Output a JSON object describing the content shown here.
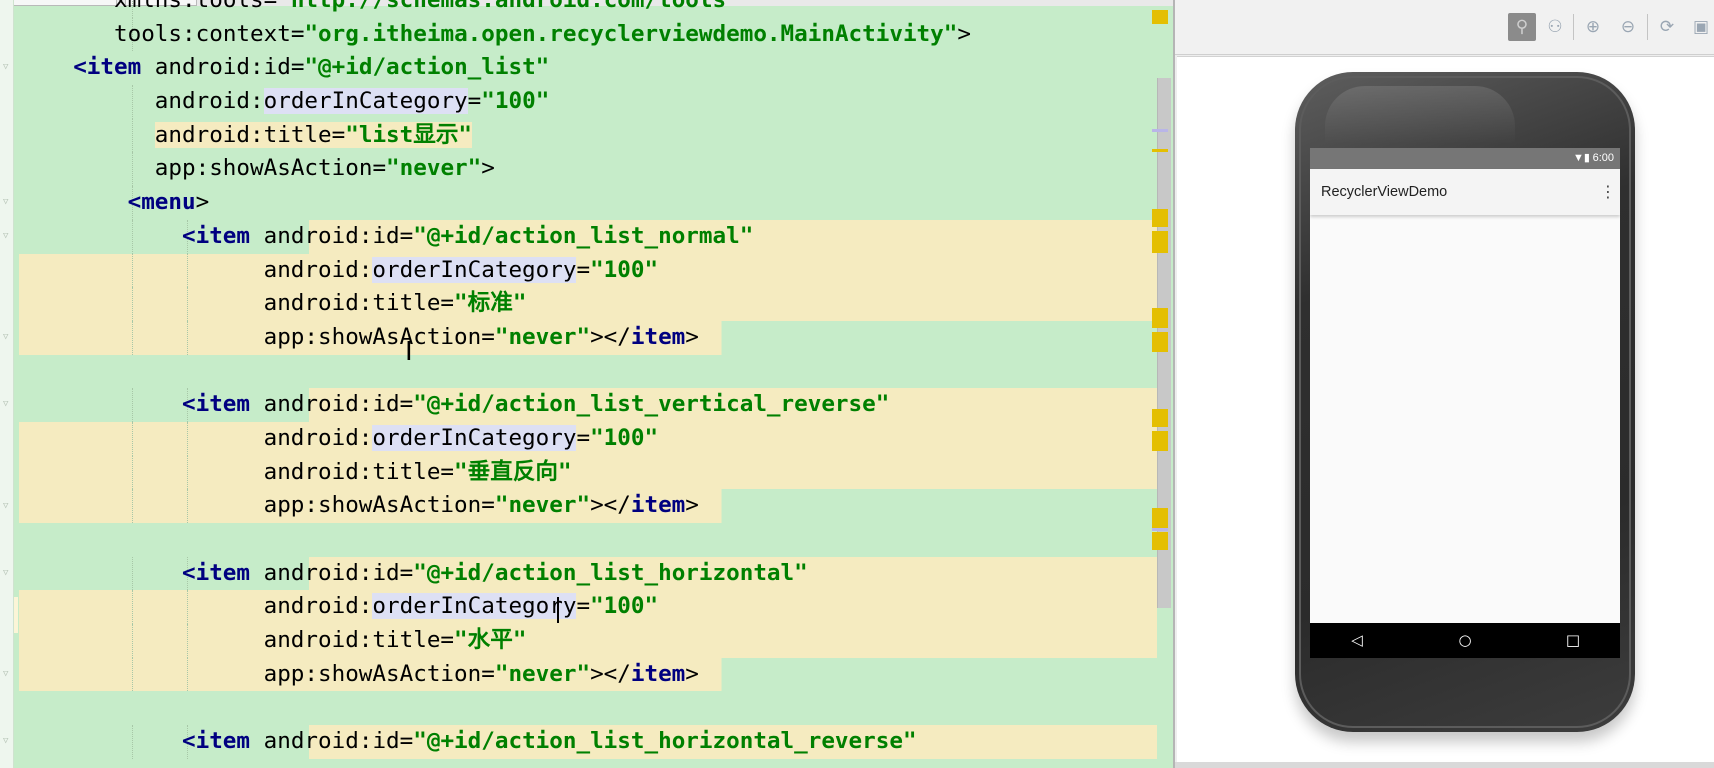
{
  "editor": {
    "lines": [
      {
        "indent": 5,
        "bg": "g",
        "tokens": [
          [
            "a",
            "xmlns:tools="
          ],
          [
            "v",
            "\"http://schemas.android.com/tools\""
          ]
        ]
      },
      {
        "indent": 5,
        "bg": "g",
        "tokens": [
          [
            "a",
            "tools:context="
          ],
          [
            "v",
            "\"org.itheima.open.recyclerviewdemo.MainActivity\""
          ],
          [
            "a",
            ">"
          ]
        ]
      },
      {
        "indent": 2,
        "bg": "g",
        "tokens": [
          [
            "t",
            "<item"
          ],
          [
            "a",
            " android:id="
          ],
          [
            "v",
            "\"@+id/action_list\""
          ]
        ]
      },
      {
        "indent": 8,
        "bg": "g",
        "tokens": [
          [
            "a",
            "android:"
          ],
          [
            "h",
            "orderInCategory"
          ],
          [
            "a",
            "="
          ],
          [
            "v",
            "\"100\""
          ]
        ]
      },
      {
        "indent": 8,
        "bg": "g",
        "tokens": [
          [
            "yb",
            "android:title="
          ],
          [
            "yv",
            "\"list显示\""
          ]
        ]
      },
      {
        "indent": 8,
        "bg": "g",
        "tokens": [
          [
            "a",
            "app:showAsAction="
          ],
          [
            "v",
            "\"never\""
          ],
          [
            "a",
            ">"
          ]
        ]
      },
      {
        "indent": 6,
        "bg": "g",
        "tokens": [
          [
            "t",
            "<menu"
          ],
          [
            "a",
            ">"
          ]
        ]
      },
      {
        "indent": 10,
        "bg": "g",
        "tokens": [
          [
            "t",
            "<item"
          ],
          [
            "a",
            " android:id="
          ],
          [
            "v",
            "\"@+id/action_list_normal\""
          ]
        ],
        "ystart": 10
      },
      {
        "indent": 16,
        "bg": "y",
        "tokens": [
          [
            "a",
            "android:"
          ],
          [
            "h",
            "orderInCategory"
          ],
          [
            "a",
            "="
          ],
          [
            "v",
            "\"100\""
          ]
        ]
      },
      {
        "indent": 16,
        "bg": "y",
        "tokens": [
          [
            "a",
            "android:title="
          ],
          [
            "v",
            "\"标准\""
          ]
        ]
      },
      {
        "indent": 16,
        "bg": "y",
        "tokens": [
          [
            "a",
            "app:showAsAction="
          ],
          [
            "v",
            "\"never\""
          ],
          [
            "a",
            "></"
          ],
          [
            "t",
            "item"
          ],
          [
            "a",
            ">"
          ]
        ],
        "yend": 39
      },
      {
        "indent": 0,
        "bg": "g",
        "tokens": []
      },
      {
        "indent": 10,
        "bg": "g",
        "tokens": [
          [
            "t",
            "<item"
          ],
          [
            "a",
            " android:id="
          ],
          [
            "v",
            "\"@+id/action_list_vertical_reverse\""
          ]
        ],
        "ystart": 10
      },
      {
        "indent": 16,
        "bg": "y",
        "tokens": [
          [
            "a",
            "android:"
          ],
          [
            "h",
            "orderInCategory"
          ],
          [
            "a",
            "="
          ],
          [
            "v",
            "\"100\""
          ]
        ]
      },
      {
        "indent": 16,
        "bg": "y",
        "tokens": [
          [
            "a",
            "android:title="
          ],
          [
            "v",
            "\"垂直反向\""
          ]
        ]
      },
      {
        "indent": 16,
        "bg": "y",
        "tokens": [
          [
            "a",
            "app:showAsAction="
          ],
          [
            "v",
            "\"never\""
          ],
          [
            "a",
            "></"
          ],
          [
            "t",
            "item"
          ],
          [
            "a",
            ">"
          ]
        ],
        "yend": 39
      },
      {
        "indent": 0,
        "bg": "g",
        "tokens": []
      },
      {
        "indent": 10,
        "bg": "g",
        "tokens": [
          [
            "t",
            "<item"
          ],
          [
            "a",
            " android:id="
          ],
          [
            "v",
            "\"@+id/action_list_horizontal\""
          ]
        ],
        "ystart": 10
      },
      {
        "indent": 16,
        "bg": "y",
        "tokens": [
          [
            "a",
            "android:"
          ],
          [
            "h",
            "orderInCategory"
          ],
          [
            "a",
            "="
          ],
          [
            "v",
            "\"100\""
          ]
        ]
      },
      {
        "indent": 16,
        "bg": "y",
        "tokens": [
          [
            "a",
            "android:title="
          ],
          [
            "v",
            "\"水平\""
          ]
        ]
      },
      {
        "indent": 16,
        "bg": "y",
        "tokens": [
          [
            "a",
            "app:showAsAction="
          ],
          [
            "v",
            "\"never\""
          ],
          [
            "a",
            "></"
          ],
          [
            "t",
            "item"
          ],
          [
            "a",
            ">"
          ]
        ],
        "yend": 39
      },
      {
        "indent": 0,
        "bg": "g",
        "tokens": []
      },
      {
        "indent": 10,
        "bg": "g",
        "tokens": [
          [
            "t",
            "<item"
          ],
          [
            "a",
            " android:id="
          ],
          [
            "v",
            "\"@+id/action_list_horizontal_reverse\""
          ]
        ],
        "ystart": 10
      }
    ]
  },
  "preview": {
    "toolbar_icons": [
      "zoom-actual-icon",
      "zoom-fit-icon",
      "zoom-in-icon",
      "zoom-out-icon",
      "refresh-icon",
      "screenshot-icon"
    ],
    "app_title": "RecyclerViewDemo",
    "status_time": "6:00",
    "nav": {
      "back": "◁",
      "home": "○",
      "recents": "□"
    }
  },
  "colors": {
    "added_bg": "#c6ecc9",
    "modified_bg": "#f5ebc0",
    "tag": "#000080",
    "value": "#008000"
  }
}
